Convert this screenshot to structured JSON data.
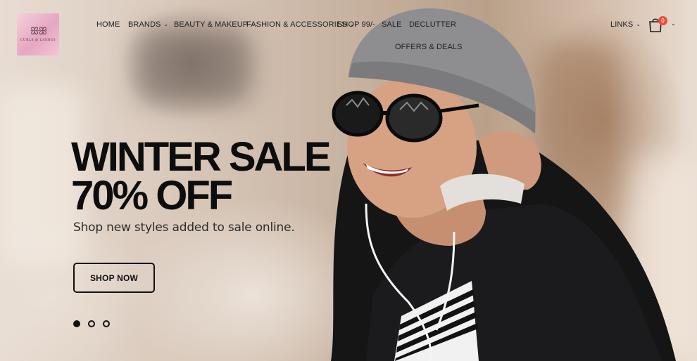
{
  "brand": {
    "mark": "ꕥ ꕥ",
    "name": "CURLS & LASHES"
  },
  "nav": {
    "home": "Home",
    "brands": "Brands",
    "beauty": "Beauty & Makeup",
    "fashion": "Fashion & Accessories",
    "shop99": "Shop 99/-",
    "sale": "Sale",
    "declutter": "Declutter",
    "offers": "Offers & Deals",
    "links": "Links"
  },
  "cart": {
    "count": "0"
  },
  "hero": {
    "headline_line1": "WINTER SALE",
    "headline_line2": "70% OFF",
    "subline": "Shop new styles added to sale online.",
    "cta": "SHOP NOW",
    "slides_total": 3,
    "active_slide": 1
  },
  "icons": {
    "chevron": "chevron-down-icon",
    "cart": "shopping-bag-icon"
  }
}
